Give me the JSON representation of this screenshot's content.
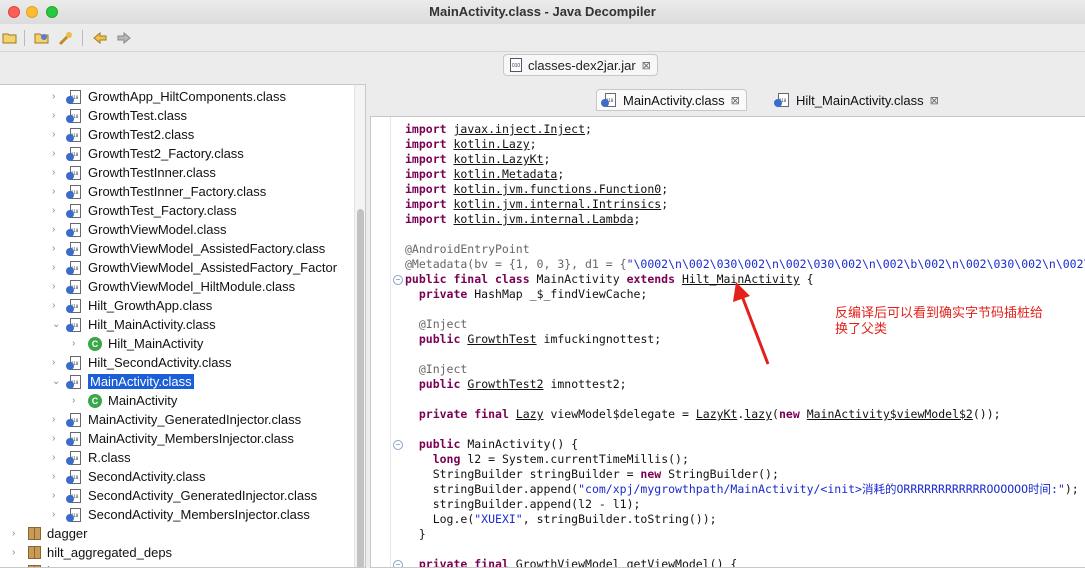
{
  "window": {
    "title": "MainActivity.class - Java Decompiler"
  },
  "toolbar": {
    "buttons": [
      "open-folder-icon",
      "open-type-icon",
      "search-icon",
      "back-icon",
      "forward-icon"
    ]
  },
  "jar_tab": {
    "label": "classes-dex2jar.jar"
  },
  "tree": {
    "items": [
      {
        "label": "GrowthApp_HiltComponents.class"
      },
      {
        "label": "GrowthTest.class"
      },
      {
        "label": "GrowthTest2.class"
      },
      {
        "label": "GrowthTest2_Factory.class"
      },
      {
        "label": "GrowthTestInner.class"
      },
      {
        "label": "GrowthTestInner_Factory.class"
      },
      {
        "label": "GrowthTest_Factory.class"
      },
      {
        "label": "GrowthViewModel.class"
      },
      {
        "label": "GrowthViewModel_AssistedFactory.class"
      },
      {
        "label": "GrowthViewModel_AssistedFactory_Factor"
      },
      {
        "label": "GrowthViewModel_HiltModule.class"
      },
      {
        "label": "Hilt_GrowthApp.class"
      },
      {
        "label": "Hilt_MainActivity.class"
      },
      {
        "label": "Hilt_MainActivity"
      },
      {
        "label": "Hilt_SecondActivity.class"
      },
      {
        "label": "MainActivity.class"
      },
      {
        "label": "MainActivity"
      },
      {
        "label": "MainActivity_GeneratedInjector.class"
      },
      {
        "label": "MainActivity_MembersInjector.class"
      },
      {
        "label": "R.class"
      },
      {
        "label": "SecondActivity.class"
      },
      {
        "label": "SecondActivity_GeneratedInjector.class"
      },
      {
        "label": "SecondActivity_MembersInjector.class"
      },
      {
        "label": "dagger"
      },
      {
        "label": "hilt_aggregated_deps"
      },
      {
        "label": "j"
      }
    ]
  },
  "editor_tabs": [
    {
      "label": "MainActivity.class"
    },
    {
      "label": "Hilt_MainActivity.class"
    }
  ],
  "code": {
    "imports": [
      {
        "kw": "import",
        "pkg": "javax.inject.Inject"
      },
      {
        "kw": "import",
        "pkg": "kotlin.Lazy"
      },
      {
        "kw": "import",
        "pkg": "kotlin.LazyKt"
      },
      {
        "kw": "import",
        "pkg": "kotlin.Metadata"
      },
      {
        "kw": "import",
        "pkg": "kotlin.jvm.functions.Function0"
      },
      {
        "kw": "import",
        "pkg": "kotlin.jvm.internal.Intrinsics"
      },
      {
        "kw": "import",
        "pkg": "kotlin.jvm.internal.Lambda"
      }
    ],
    "ann_entry": "@AndroidEntryPoint",
    "metadata_prefix": "@Metadata(bv = {1, 0, 3}, d1 = {",
    "metadata_str": "\"\\0002\\n\\002\\030\\002\\n\\002\\030\\002\\n\\002\\b\\002\\n\\002\\030\\002\\n\\002\\030\\002\\n\\002\\030",
    "class_decl": {
      "mods": "public final class",
      "name": " MainActivity ",
      "ext": "extends",
      "parent": "Hilt_MainActivity",
      "brace": " {"
    },
    "field_cache": {
      "mods": "private",
      "rest": " HashMap _$_findViewCache;"
    },
    "inject1": "@Inject",
    "field1": {
      "mods": "public",
      "type": "GrowthTest",
      "name": " imfuckingnottest;"
    },
    "inject2": "@Inject",
    "field2": {
      "mods": "public",
      "type": "GrowthTest2",
      "name": " imnottest2;"
    },
    "field3": {
      "mods": "private final",
      "type": "Lazy",
      "mid": " viewModel$delegate = ",
      "call": "LazyKt",
      "dot": ".",
      "fn": "lazy",
      "paren": "(",
      "nw": "new",
      "cls": "MainActivity$viewModel$2",
      "end": "());"
    },
    "ctor": {
      "mods": "public",
      "rest": " MainActivity() {"
    },
    "line_long": {
      "kw": "long",
      "rest": " l2 = System.currentTimeMillis();"
    },
    "line_sb": {
      "pre": "StringBuilder stringBuilder = ",
      "kw": "new",
      "post": " StringBuilder();"
    },
    "line_append": {
      "pre": "stringBuilder.append(",
      "str": "\"com/xpj/mygrowthpath/MainActivity/<init>消耗的ORRRRRRRRRRRROOOOOO时间:\"",
      "post": ");"
    },
    "line_append2": "stringBuilder.append(l2 - l1);",
    "line_log": {
      "pre": "Log.e(",
      "str": "\"XUEXI\"",
      "post": ", stringBuilder.toString());"
    },
    "close_brace": "}",
    "getter": {
      "mods": "private final",
      "rest": " GrowthViewModel getViewModel() {"
    }
  },
  "annotation_note": {
    "line1": "反编译后可以看到确实字节码插桩给",
    "line2": "换了父类",
    "color": "#e3211a"
  }
}
